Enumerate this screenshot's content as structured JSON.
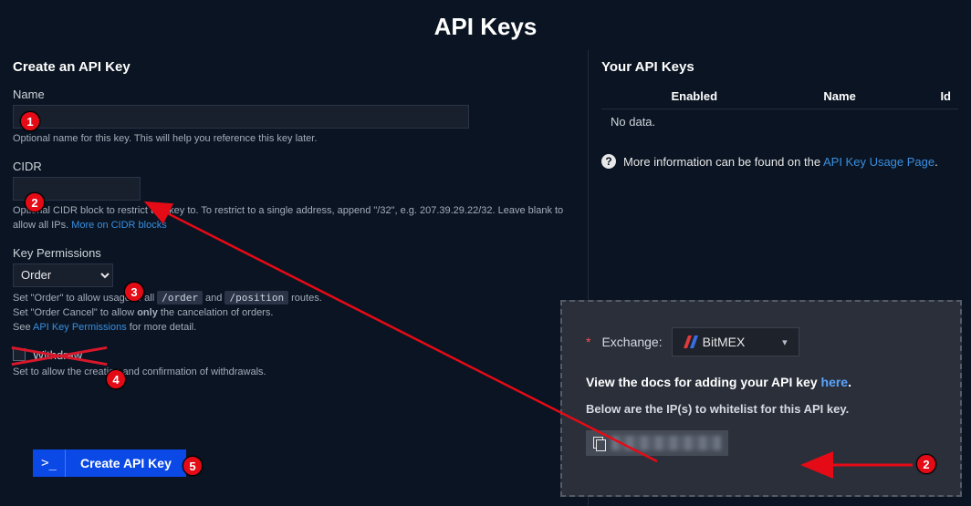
{
  "page_title": "API Keys",
  "left": {
    "title": "Create an API Key",
    "name": {
      "label": "Name",
      "value": "",
      "helper": "Optional name for this key. This will help you reference this key later."
    },
    "cidr": {
      "label": "CIDR",
      "value": "",
      "helper_pre": "Optional CIDR block to restrict this key to. To restrict to a single address, append \"/32\", e.g. 207.39.29.22/32. Leave blank to allow all IPs. ",
      "helper_link": "More on CIDR blocks"
    },
    "perms": {
      "label": "Key Permissions",
      "selected": "Order",
      "helper_1a": "Set \"Order\" to allow usage of all ",
      "route1": "/order",
      "and": " and ",
      "route2": "/position",
      "helper_1b": " routes.",
      "helper_2": "Set \"Order Cancel\" to allow only the cancelation of orders.",
      "helper_3a": "See ",
      "helper_3_link": "API Key Permissions",
      "helper_3b": " for more detail."
    },
    "withdraw": {
      "label": "Withdraw",
      "helper": "Set to allow the creation and confirmation of withdrawals."
    },
    "button": {
      "icon_text": ">_",
      "label": "Create API Key"
    }
  },
  "right": {
    "title": "Your API Keys",
    "cols": {
      "enabled": "Enabled",
      "name": "Name",
      "id": "Id"
    },
    "no_data": "No data.",
    "info_pre": "More information can be found on the ",
    "info_link": "API Key Usage Page",
    "info_post": "."
  },
  "overlay": {
    "exchange_label": "Exchange:",
    "exchange_value": "BitMEX",
    "docs_pre": "View the docs for adding your API key ",
    "docs_link": "here",
    "docs_post": ".",
    "ips_text": "Below are the IP(s) to whitelist for this API key."
  },
  "badges": {
    "b1": "1",
    "b2": "2",
    "b3": "3",
    "b4": "4",
    "b5": "5",
    "b2ov": "2"
  }
}
